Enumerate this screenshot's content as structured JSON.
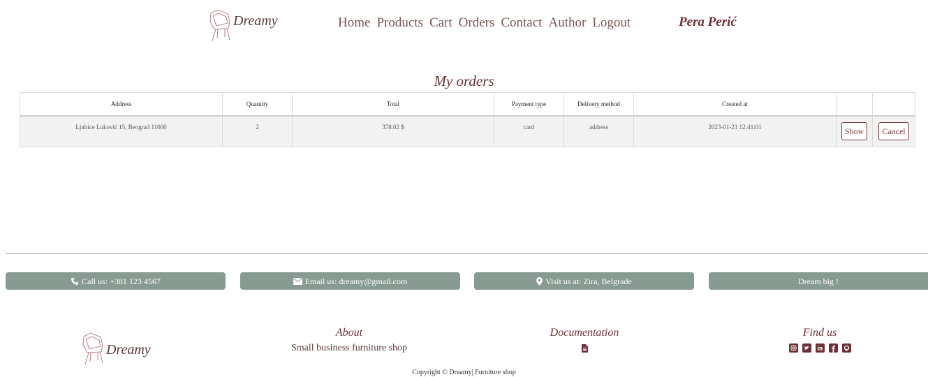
{
  "header": {
    "logo_text": "Dreamy",
    "nav": [
      "Home",
      "Products",
      "Cart",
      "Orders",
      "Contact",
      "Author",
      "Logout"
    ],
    "user_name": "Pera Perić"
  },
  "page_title": "My orders",
  "orders_table": {
    "columns": [
      "Address",
      "Quantity",
      "Total",
      "Payment type",
      "Delivery method",
      "Created at",
      "",
      ""
    ],
    "rows": [
      {
        "address": "Ljubice Luković 15, Beograd 11000",
        "quantity": "2",
        "total": "378.02 $",
        "payment_type": "card",
        "delivery_method": "address",
        "created_at": "2023-01-21 12:41:01",
        "show_label": "Show",
        "cancel_label": "Cancel"
      }
    ]
  },
  "contact_bar": {
    "phone": "Call us: +381 123 4567",
    "email": "Email us: dreamy@gmail.com",
    "visit": "Visit us at: Zira, Belgrade",
    "slogan": "Dream big !"
  },
  "footer": {
    "logo_text": "Dreamy",
    "about_heading": "About",
    "about_text": "Small business furniture shop",
    "documentation_heading": "Documentation",
    "find_us_heading": "Find us",
    "social_icons": [
      "instagram-icon",
      "twitter-icon",
      "linkedin-icon",
      "facebook-icon",
      "github-icon"
    ],
    "copyright": "Copyright © Dreamy| Furniture shop"
  },
  "colors": {
    "accent": "#6e2f33",
    "nav_text": "#7b5252",
    "pill_bg": "#879b92",
    "row_bg": "#f2f2f2"
  }
}
